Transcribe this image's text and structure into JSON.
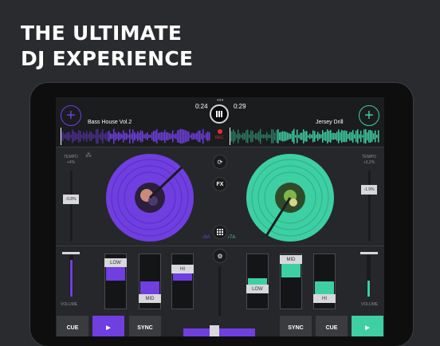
{
  "headline": {
    "line1": "THE ULTIMATE",
    "line2": "DJ EXPERIENCE"
  },
  "deck_a": {
    "track": "Bass House Vol.2",
    "time": "0:24",
    "tempo_label": "TEMPO",
    "tempo_value": "+4%",
    "pitch_value": "-0.8%",
    "key": "9A",
    "color": "#6f3fe0"
  },
  "deck_b": {
    "track": "Jersey Drill",
    "time": "0:29",
    "tempo_label": "TEMPO",
    "tempo_value": "+3.2%",
    "pitch_value": "-1.9%",
    "key": "7A",
    "color": "#3ecfa3"
  },
  "center": {
    "rec_label": "REC",
    "fx_label": "FX"
  },
  "mixer": {
    "volume_label": "VOLUME",
    "deck_a_eq": {
      "low": "LOW",
      "mid": "MID",
      "hi": "HI"
    },
    "deck_b_eq": {
      "low": "LOW",
      "mid": "MID",
      "hi": "HI"
    }
  },
  "bottom": {
    "cue": "CUE",
    "sync": "SYNC"
  },
  "icons": [
    "plus-icon",
    "loop-icon",
    "grid-icon",
    "settings-icon",
    "play-icon",
    "music-note-icon"
  ]
}
